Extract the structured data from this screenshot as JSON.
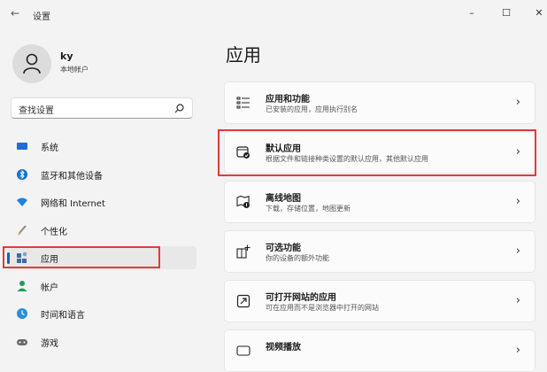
{
  "window": {
    "back_glyph": "←",
    "title": "设置",
    "minimize_glyph": "–",
    "maximize_glyph": "☐",
    "close_glyph": "✕"
  },
  "profile": {
    "name": "ky",
    "account_type": "本地帐户"
  },
  "search": {
    "placeholder": "查找设置"
  },
  "sidebar": {
    "items": [
      {
        "label": "系统",
        "icon": "monitor-icon",
        "color": "#1e6fd0"
      },
      {
        "label": "蓝牙和其他设备",
        "icon": "bluetooth-icon",
        "color": "#0a74d8"
      },
      {
        "label": "网络和 Internet",
        "icon": "wifi-icon",
        "color": "#1a84e0"
      },
      {
        "label": "个性化",
        "icon": "brush-icon",
        "color": "#c77a1e"
      },
      {
        "label": "应用",
        "icon": "apps-icon",
        "color": "#3a6ea8",
        "active": true
      },
      {
        "label": "帐户",
        "icon": "person-icon",
        "color": "#1e9e57"
      },
      {
        "label": "时间和语言",
        "icon": "globe-clock-icon",
        "color": "#2a8fd6"
      },
      {
        "label": "游戏",
        "icon": "gamepad-icon",
        "color": "#6a6a6a"
      }
    ]
  },
  "main": {
    "title": "应用",
    "cards": [
      {
        "title": "应用和功能",
        "desc": "已安装的应用，应用执行别名",
        "icon": "list-icon"
      },
      {
        "title": "默认应用",
        "desc": "根据文件和链接种类设置的默认应用，其他默认应用",
        "icon": "default-apps-icon"
      },
      {
        "title": "离线地图",
        "desc": "下载，存储位置，地图更新",
        "icon": "map-icon"
      },
      {
        "title": "可选功能",
        "desc": "你的设备的额外功能",
        "icon": "add-feature-icon"
      },
      {
        "title": "可打开网站的应用",
        "desc": "可在应用而不是浏览器中打开的网站",
        "icon": "open-web-icon"
      },
      {
        "title": "视频播放",
        "desc": "",
        "icon": "video-icon"
      }
    ],
    "chevron": "›"
  },
  "colors": {
    "accent": "#0067c0",
    "highlight_red": "#e23a3a"
  }
}
